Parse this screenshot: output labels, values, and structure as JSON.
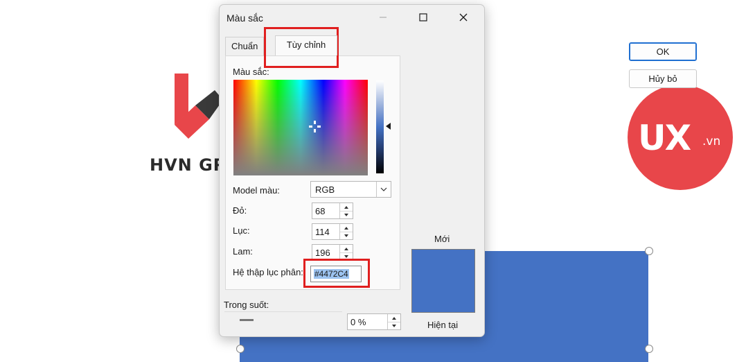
{
  "background": {
    "left_logo_text": "HVN GR",
    "right_logo_main": "UX",
    "right_logo_suffix": ".vn",
    "shape_color": "#4472c4"
  },
  "dialog": {
    "title": "Màu sắc",
    "tabs": [
      {
        "label": "Chuẩn"
      },
      {
        "label": "Tùy chỉnh"
      }
    ],
    "colors_label": "Màu sắc:",
    "color_model_label": "Model màu:",
    "color_model_value": "RGB",
    "red_label": "Đỏ:",
    "red_value": "68",
    "green_label": "Lục:",
    "green_value": "114",
    "blue_label": "Lam:",
    "blue_value": "196",
    "hex_label": "Hệ thập lục phân:",
    "hex_value": "#4472C4",
    "transparency_label": "Trong suốt:",
    "transparency_value": "0 %",
    "ok_label": "OK",
    "cancel_label": "Hủy bỏ",
    "new_label": "Mới",
    "current_label": "Hiện tại",
    "new_color": "#4472c4",
    "current_color": "#4472c4",
    "highlight_color": "#e01f1f"
  }
}
